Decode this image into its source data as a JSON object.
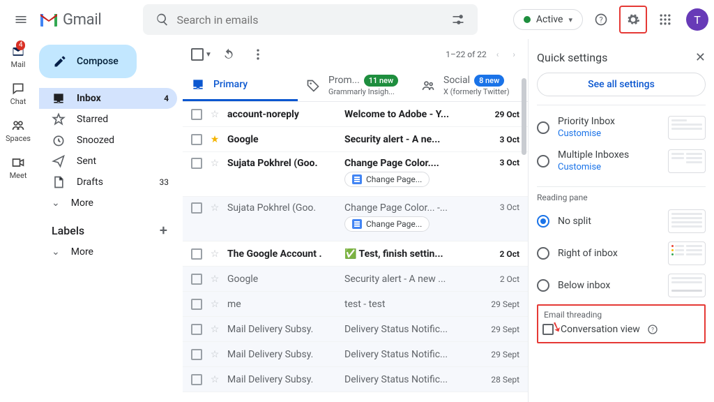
{
  "header": {
    "logo_text": "Gmail",
    "search_placeholder": "Search in emails",
    "active_label": "Active",
    "avatar_letter": "T"
  },
  "rail": {
    "mail": "Mail",
    "mail_badge": "4",
    "chat": "Chat",
    "spaces": "Spaces",
    "meet": "Meet"
  },
  "sidebar": {
    "compose": "Compose",
    "items": [
      {
        "name": "Inbox",
        "count": "4",
        "selected": true
      },
      {
        "name": "Starred"
      },
      {
        "name": "Snoozed"
      },
      {
        "name": "Sent"
      },
      {
        "name": "Drafts",
        "count": "33"
      },
      {
        "name": "More"
      }
    ],
    "labels_header": "Labels",
    "labels_more": "More"
  },
  "toolbar": {
    "range": "1–22 of 22"
  },
  "tabs": {
    "primary": "Primary",
    "promotions_label": "Prom...",
    "promotions_badge": "11 new",
    "promotions_sub": "Grammarly Insigh...",
    "social_label": "Social",
    "social_badge": "8 new",
    "social_sub": "X (formerly Twitter)"
  },
  "rows": [
    {
      "sender": "account-noreply",
      "subject_bold": "Welcome to Adobe",
      "subject_rest": " - Y...",
      "date": "29 Oct",
      "unread": true
    },
    {
      "sender": "Google",
      "subject_bold": "Security alert",
      "subject_rest": " - A ne...",
      "date": "3 Oct",
      "unread": true,
      "starred": true
    },
    {
      "sender": "Sujata Pokhrel (Goo.",
      "subject_bold": "Change Page Color....",
      "subject_rest": "",
      "date": "3 Oct",
      "unread": true,
      "chip": "Change Page..."
    },
    {
      "sender": "Sujata Pokhrel (Goo.",
      "subject_bold": "",
      "subject_rest": "Change Page Color... -...",
      "date": "3 Oct",
      "unread": false,
      "chip": "Change Page..."
    },
    {
      "sender": "The Google Account .",
      "subject_bold": "✅ Test, finish settin...",
      "subject_rest": "",
      "date": "2 Oct",
      "unread": true,
      "emoji": true
    },
    {
      "sender": "Google",
      "subject_bold": "",
      "subject_rest": "Security alert - A new ...",
      "date": "2 Oct",
      "unread": false
    },
    {
      "sender": "me",
      "subject_bold": "",
      "subject_rest": "test - test",
      "date": "29 Sept",
      "unread": false
    },
    {
      "sender": "Mail Delivery Subsy.",
      "subject_bold": "",
      "subject_rest": "Delivery Status Notific...",
      "date": "29 Sept",
      "unread": false
    },
    {
      "sender": "Mail Delivery Subsy.",
      "subject_bold": "",
      "subject_rest": "Delivery Status Notific...",
      "date": "29 Sept",
      "unread": false
    },
    {
      "sender": "Mail Delivery Subsy.",
      "subject_bold": "",
      "subject_rest": "Delivery Status Notific...",
      "date": "28 Sept",
      "unread": false
    }
  ],
  "qs": {
    "title": "Quick settings",
    "see_all": "See all settings",
    "density": {
      "priority": "Priority Inbox",
      "multiple": "Multiple Inboxes",
      "customise": "Customise"
    },
    "reading_pane": {
      "title": "Reading pane",
      "no_split": "No split",
      "right": "Right of inbox",
      "below": "Below inbox"
    },
    "threading": {
      "title": "Email threading",
      "conversation_view": "Conversation view"
    }
  }
}
